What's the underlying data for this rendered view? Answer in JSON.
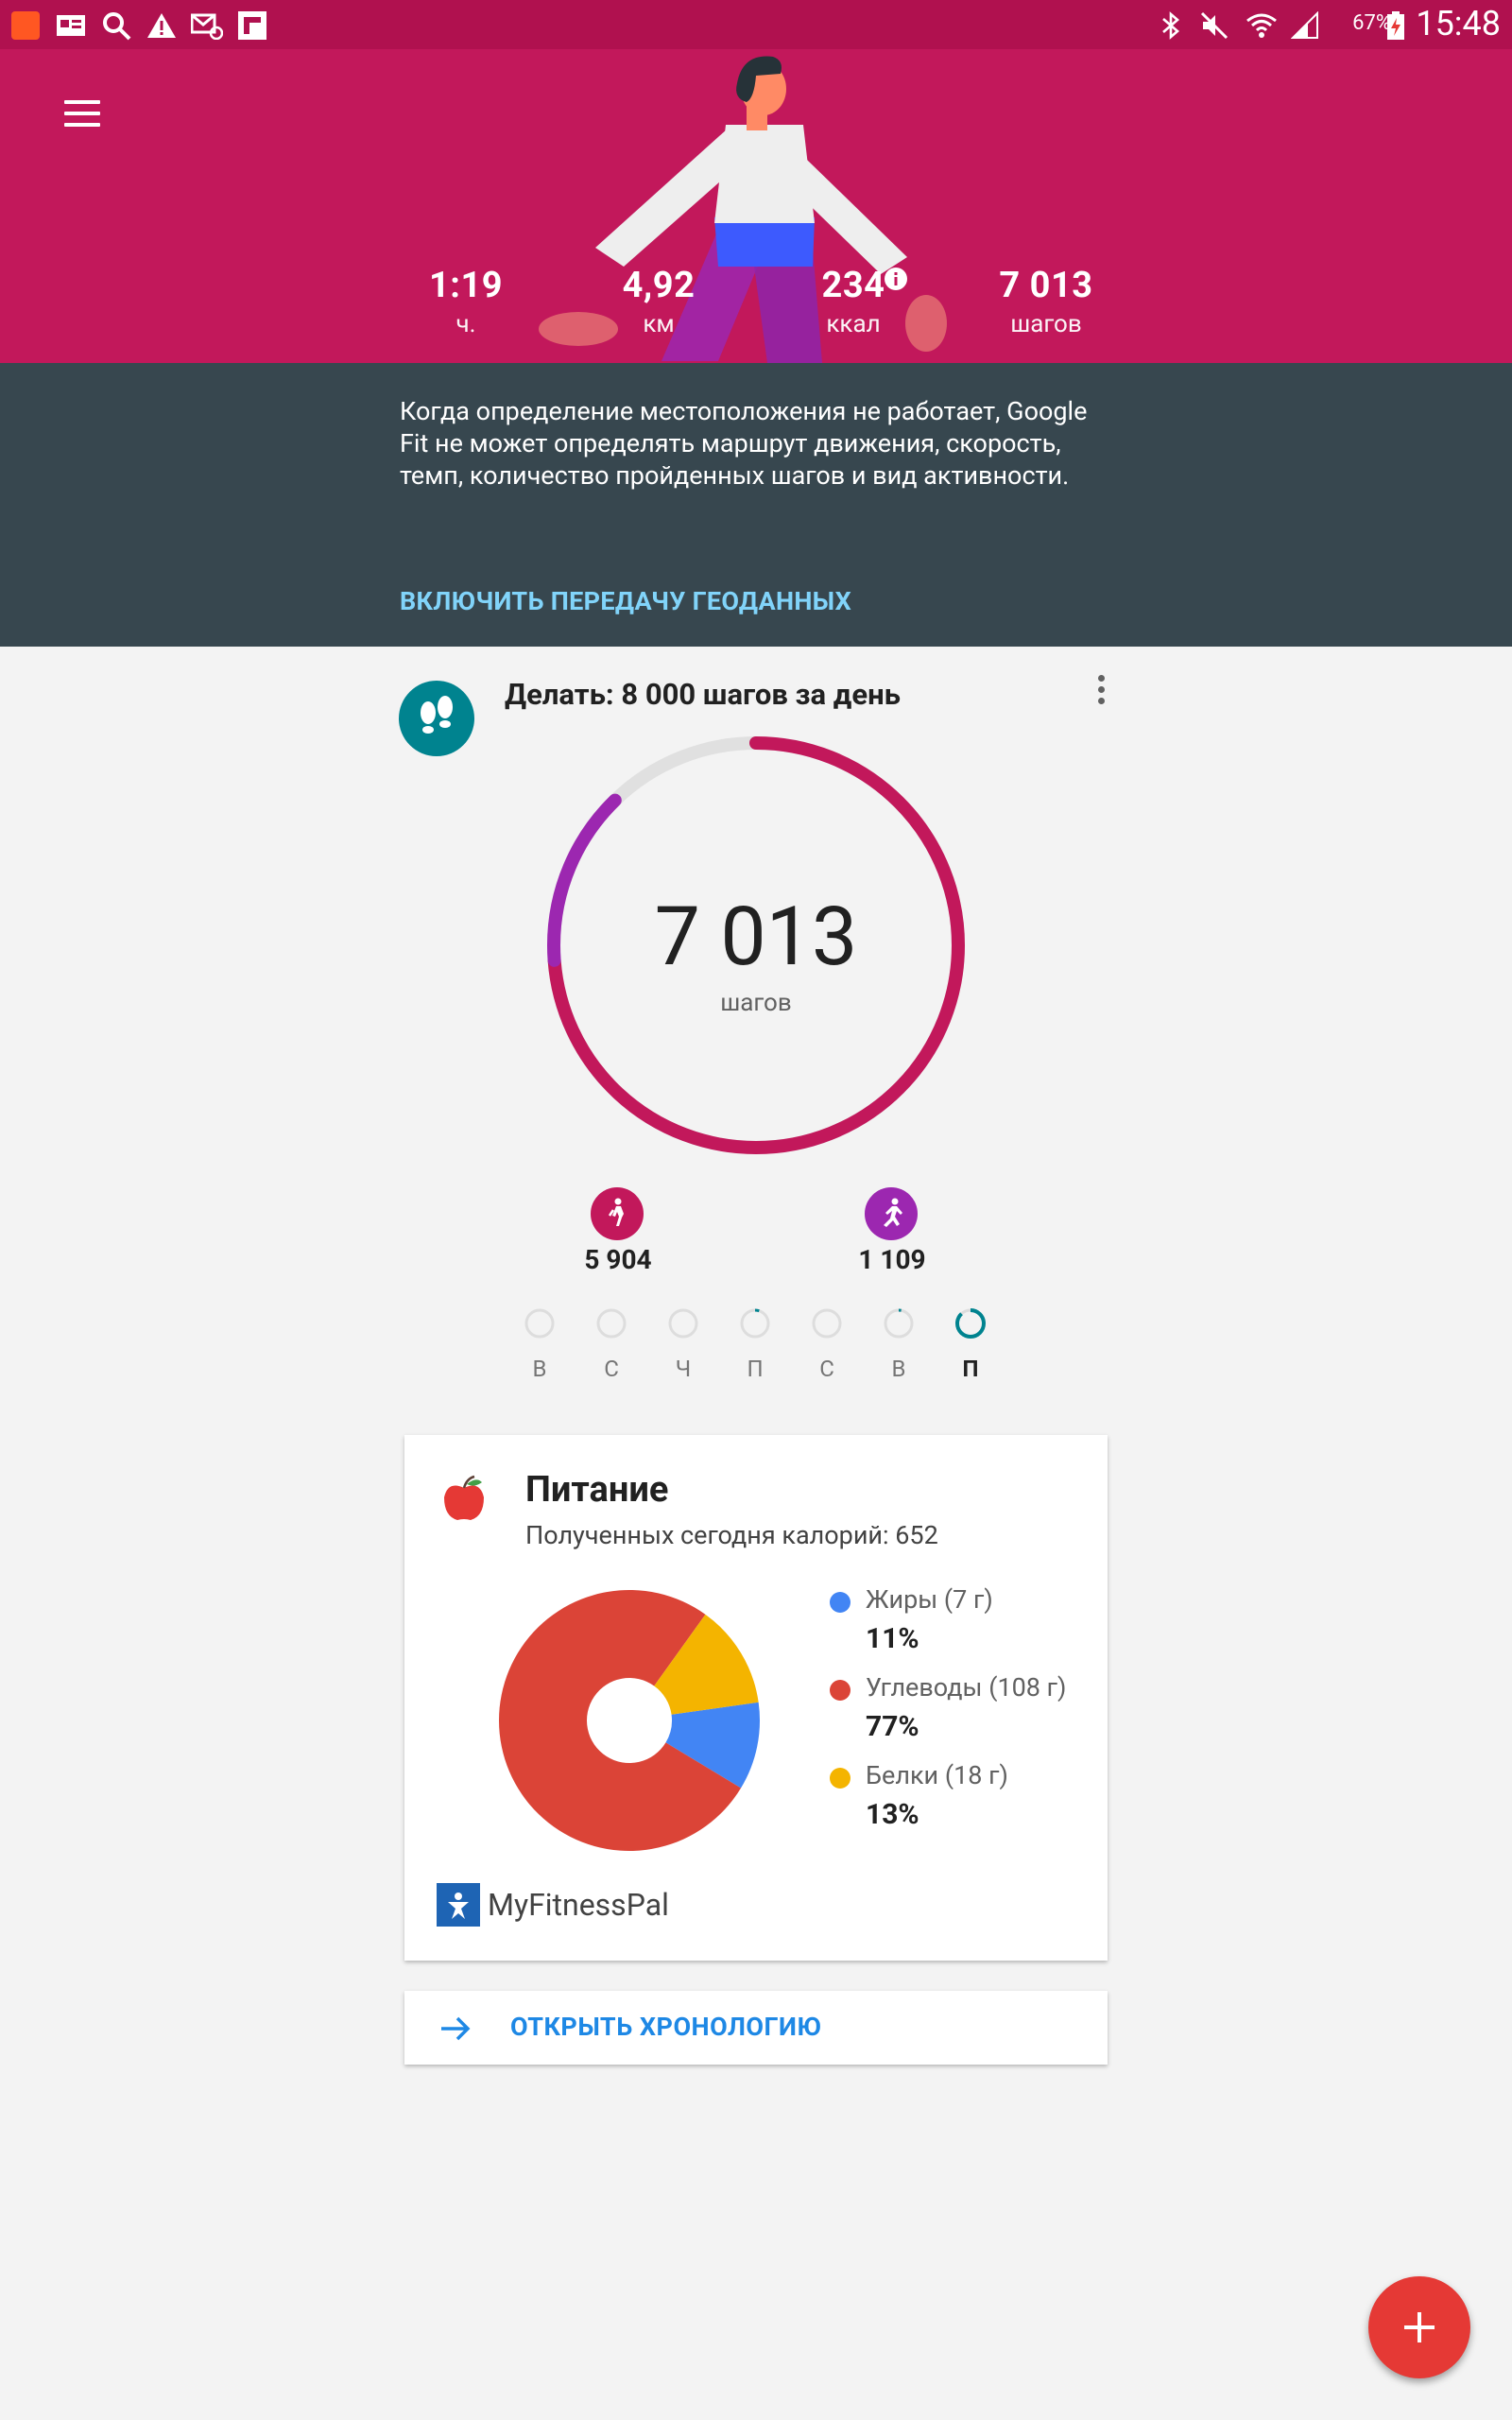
{
  "status_bar": {
    "battery_percent": "67%",
    "time": "15:48",
    "left_icons": [
      "app-notification-icon",
      "news-icon",
      "search-icon",
      "warning-icon",
      "email-icon",
      "flipboard-icon"
    ],
    "right_icons": [
      "bluetooth-icon",
      "mute-icon",
      "wifi-icon",
      "signal-icon",
      "battery-icon"
    ]
  },
  "header": {
    "stats": [
      {
        "value": "1:19",
        "label": "ч."
      },
      {
        "value": "4,92",
        "label": "км"
      },
      {
        "value": "234",
        "label": "ккал"
      },
      {
        "value": "7 013",
        "label": "шагов"
      }
    ]
  },
  "notice": {
    "text": "Когда определение местоположения не работает, Google Fit не может определять маршрут движения, скорость, темп, количество пройденных шагов и вид активности.",
    "action": "ВКЛЮЧИТЬ ПЕРЕДАЧУ ГЕОДАННЫХ"
  },
  "goal": {
    "title": "Делать: 8 000 шагов за день",
    "steps_value": "7 013",
    "steps_unit": "шагов",
    "progress_fraction": 0.877,
    "walking_fraction": 0.738,
    "running_fraction": 0.139,
    "activities": [
      {
        "value": "5 904",
        "color": "#c2185b",
        "icon": "walking-icon"
      },
      {
        "value": "1 109",
        "color": "#9c27b0",
        "icon": "running-icon"
      }
    ],
    "days": [
      {
        "label": "В",
        "progress": 0,
        "active": false
      },
      {
        "label": "С",
        "progress": 0,
        "active": false
      },
      {
        "label": "Ч",
        "progress": 0,
        "active": false
      },
      {
        "label": "П",
        "progress": 0.05,
        "active": false
      },
      {
        "label": "С",
        "progress": 0,
        "active": false
      },
      {
        "label": "В",
        "progress": 0.03,
        "active": false
      },
      {
        "label": "П",
        "progress": 0.88,
        "active": true
      }
    ]
  },
  "nutrition": {
    "title": "Питание",
    "subtitle": "Полученных сегодня калорий: 652",
    "legend": [
      {
        "name": "Жиры (7 г)",
        "percent": "11%",
        "color": "#4285f4"
      },
      {
        "name": "Углеводы (108 г)",
        "percent": "77%",
        "color": "#db4437"
      },
      {
        "name": "Белки (18 г)",
        "percent": "13%",
        "color": "#f4b400"
      }
    ],
    "source": "MyFitnessPal"
  },
  "timeline": {
    "label": "ОТКРЫТЬ ХРОНОЛОГИЮ"
  },
  "colors": {
    "header": "#c2185b",
    "notice": "#37474f",
    "accent_teal": "#00838f",
    "link": "#1e88e5",
    "fab": "#e53935"
  }
}
